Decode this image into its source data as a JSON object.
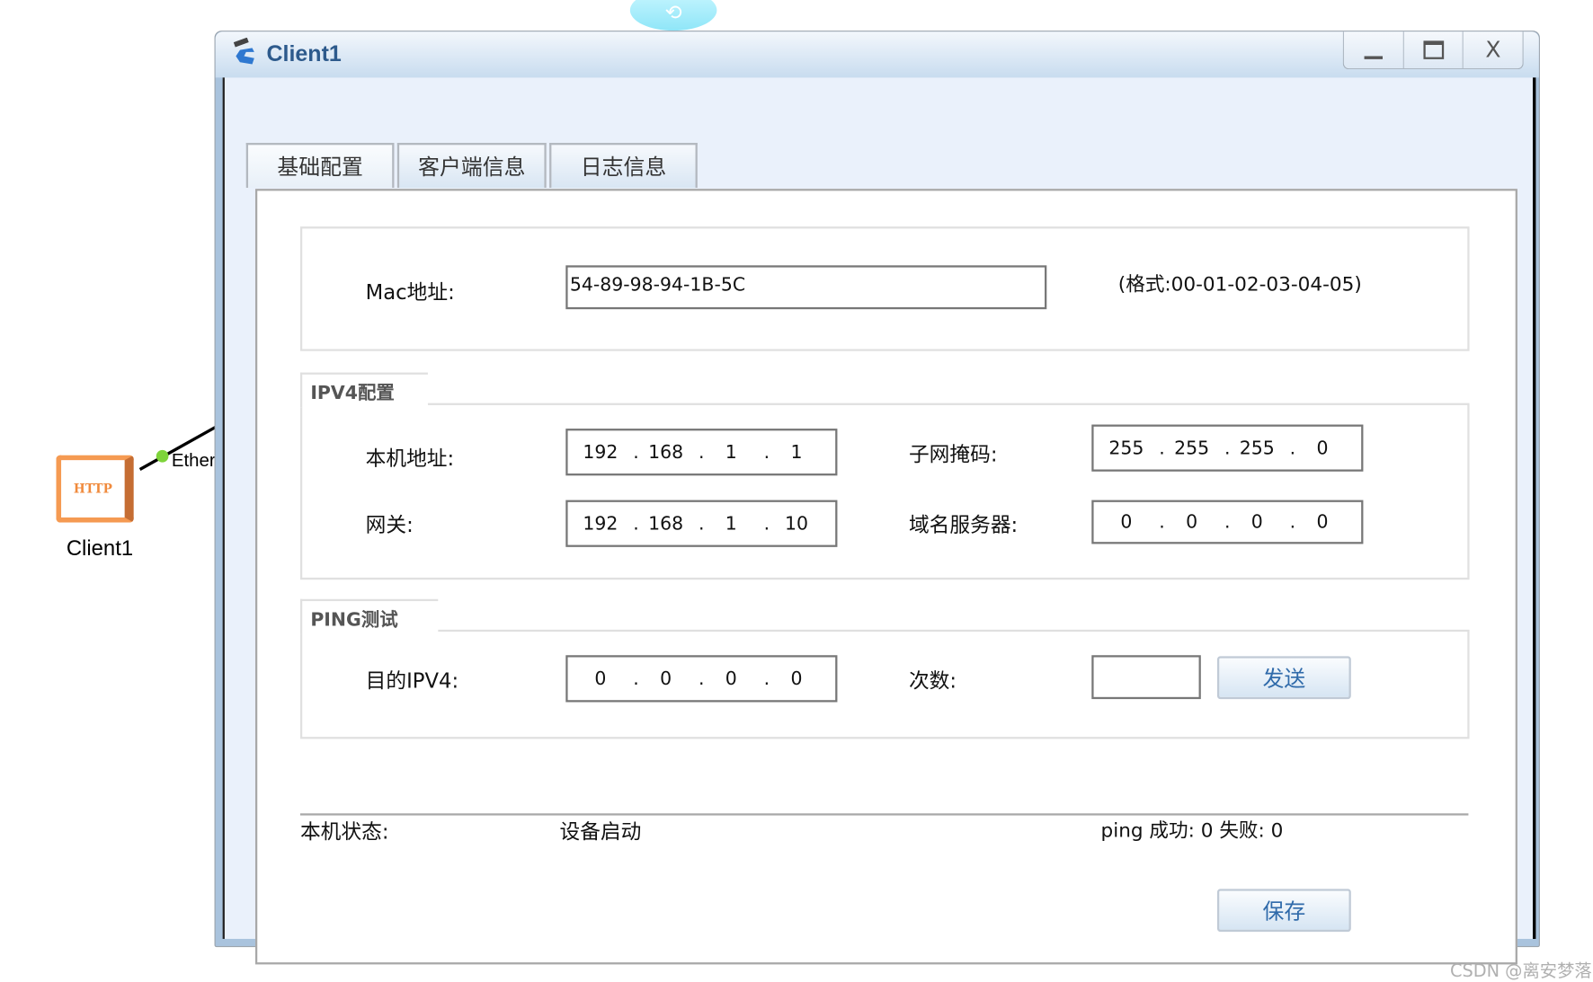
{
  "topology": {
    "client_label": "Client1",
    "link_label": "Ether",
    "client_icon_text": "HTTP"
  },
  "window": {
    "title": "Client1",
    "minimize": "_",
    "maximize": "□",
    "close": "X"
  },
  "tabs": [
    {
      "label": "基础配置",
      "active": true
    },
    {
      "label": "客户端信息"
    },
    {
      "label": "日志信息"
    }
  ],
  "mac": {
    "label": "Mac地址:",
    "value": "54-89-98-94-1B-5C",
    "format_hint": "(格式:00-01-02-03-04-05)"
  },
  "ipv4": {
    "legend": "IPV4配置",
    "local_ip": {
      "label": "本机地址:",
      "octets": [
        "192",
        "168",
        "1",
        "1"
      ]
    },
    "subnet_mask": {
      "label": "子网掩码:",
      "octets": [
        "255",
        "255",
        "255",
        "0"
      ]
    },
    "gateway": {
      "label": "网关:",
      "octets": [
        "192",
        "168",
        "1",
        "10"
      ]
    },
    "dns": {
      "label": "域名服务器:",
      "octets": [
        "0",
        "0",
        "0",
        "0"
      ]
    }
  },
  "ping": {
    "legend": "PING测试",
    "dest": {
      "label": "目的IPV4:",
      "octets": [
        "0",
        "0",
        "0",
        "0"
      ]
    },
    "count_label": "次数:",
    "count_value": "",
    "send_label": "发送"
  },
  "status": {
    "label": "本机状态:",
    "value": "设备启动",
    "ping_result": "ping 成功: 0 失败: 0"
  },
  "save_label": "保存",
  "watermark": "CSDN @离安梦落",
  "colors": {
    "title": "#2d5a8c",
    "button_text": "#2f6aaa",
    "client_icon": "#f08a3c",
    "link_dot": "#7ed43a"
  }
}
